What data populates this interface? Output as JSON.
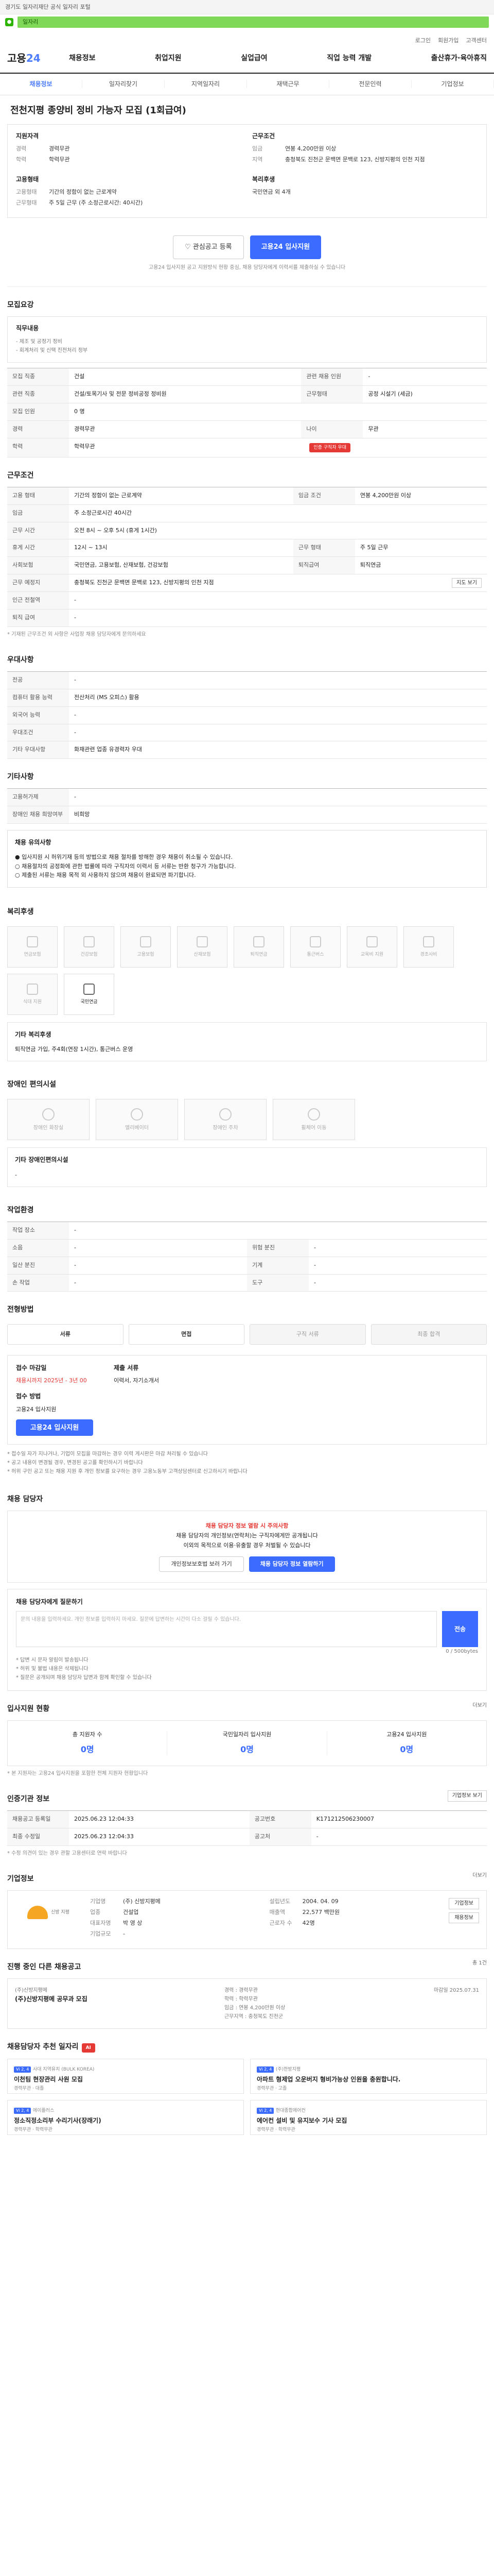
{
  "banner": {
    "top": "경기도 일자리재단 공식 일자리 포털",
    "url": "일자리"
  },
  "util": [
    "로그인",
    "회원가입",
    "고객센터"
  ],
  "gnb": {
    "logo_a": "고용",
    "logo_b": "24",
    "items": [
      "채용정보",
      "취업지원",
      "실업급여",
      "직업 능력 개발",
      "출산휴가·육아휴직"
    ]
  },
  "subnav": [
    "채용정보",
    "일자리찾기",
    "지역일자리",
    "재택근무",
    "전문인력",
    "기업정보"
  ],
  "job": {
    "title": "전천지평 종양비 정비 가능자 모집 (1회급여)"
  },
  "summary": {
    "left_h": "지원자격",
    "left": [
      {
        "k": "경력",
        "v": "경력무관"
      },
      {
        "k": "학력",
        "v": "학력무관"
      }
    ],
    "cond_h": "고용형태",
    "cond": [
      {
        "k": "고용형태",
        "v": "기간의 정함이 없는 근로계약"
      },
      {
        "k": "근무형태",
        "v": "주 5일 근무 (주 소정근로시간: 40시간)"
      }
    ],
    "right_h": "근무조건",
    "right": [
      {
        "k": "임금",
        "v": "연봉 4,200만원 이상"
      },
      {
        "k": "지역",
        "v": "충청북도 진천군 문백면 문백로 123, 신방지평의 인천 지점"
      }
    ],
    "right2_h": "복리후생",
    "right2": [
      {
        "k": "",
        "v": "국민연금 외 4개"
      }
    ],
    "btn_scrap": "관심공고 등록",
    "btn_apply": "고용24 입사지원",
    "note": "고용24 입사지원 공고 지원방식 현황 중심, 채용 담당자에게 이력서를 제출하실 수 있습니다"
  },
  "sec1": {
    "h": "모집요강",
    "h2": "직무내용",
    "bullets": [
      "- 제조 및 공정기 정비",
      "- 회계처리 및 신택 진전처리 정부"
    ],
    "rows": [
      {
        "k": "모집 직종",
        "v": "건설"
      },
      {
        "k": "관련 직종",
        "v": "건설/토목기사 및 전문 정비공정 정비원"
      },
      {
        "k": "모집 인원",
        "v": "0 명"
      },
      {
        "k": "경력",
        "v": "경력무관"
      },
      {
        "k": "학력",
        "v": "학력무관"
      }
    ],
    "rows_r": [
      {
        "k": "관련 채용 인원",
        "v": "-"
      },
      {
        "k": "근무형태",
        "v": "공정 시설기 (세금)"
      },
      {
        "k": "",
        "v": "-"
      },
      {
        "k": "나이",
        "v": "무관"
      }
    ],
    "badge": "인증 구직자 우대"
  },
  "sec2": {
    "h": "근무조건",
    "rows": [
      {
        "k": "고용 형태",
        "v": "기간의 정함이 없는 근로계약"
      },
      {
        "k": "임금",
        "v": "주 소정근로시간 40시간"
      },
      {
        "k": "근무 시간",
        "v": "오전 8시 ~ 오후 5시 (휴게 1시간)"
      },
      {
        "k": "휴게 시간",
        "v": "12시 ~ 13시"
      },
      {
        "k": "사회보험",
        "v": "국민연금, 고용보험, 산재보험, 건강보험"
      },
      {
        "k": "근무 예정지",
        "v": "충청북도 진천군 문백면 문백로 123, 신방지평의 인천 지점"
      },
      {
        "k": "인근 전철역",
        "v": "-"
      },
      {
        "k": "퇴직 급여",
        "v": "-"
      }
    ],
    "rows_r": [
      {
        "k": "임금 조건",
        "v": "연봉 4,200만원 이상"
      },
      {
        "k": "근무 형태",
        "v": "주 5일 근무"
      },
      {
        "k": "퇴직급여",
        "v": "퇴직연금"
      }
    ],
    "map": "지도 보기",
    "foot": "* 기재된 근무조건 외 사항은 사업장 채용 담당자에게 문의하세요"
  },
  "sec3": {
    "h": "우대사항",
    "rows": [
      {
        "k": "전공",
        "v": "-"
      },
      {
        "k": "컴퓨터 활용 능력",
        "v": "전산처리 (MS 오피스) 활용"
      },
      {
        "k": "외국어 능력",
        "v": "-"
      },
      {
        "k": "우대조건",
        "v": "-"
      },
      {
        "k": "기타 우대사항",
        "v": "화재관련 업종 유경력자 우대"
      }
    ]
  },
  "sec4": {
    "h": "기타사항",
    "rows": [
      {
        "k": "고용허가제",
        "v": "-"
      },
      {
        "k": "장애인 채용 희망여부",
        "v": "비희망"
      }
    ],
    "notice_h": "채용 유의사항",
    "notice": [
      "● 입사지원 시 허위기재 등의 방법으로 채용 절차를 방해한 경우 채용이 취소될 수 있습니다.",
      "○ 채용절차의 공정화에 관한 법률에 따라 구직자의 이력서 등 서류는 반환 청구가 가능합니다.",
      "○ 제출된 서류는 채용 목적 외 사용하지 않으며 채용이 완료되면 파기합니다."
    ]
  },
  "sec5": {
    "h": "복리후생",
    "tiles": [
      "연금보험",
      "건강보험",
      "고용보험",
      "산재보험",
      "퇴직연금",
      "통근버스",
      "교육비 지원",
      "경조사비",
      "식대 지원",
      "국민연금"
    ],
    "info_h": "기타 복리후생",
    "info": "퇴직연금 가입, 주4회(연장 1시간), 통근버스 운영"
  },
  "sec6": {
    "h": "장애인 편의시설",
    "tiles": [
      "장애인 화장실",
      "엘리베이터",
      "장애인 주차",
      "휠체어 이동"
    ],
    "info_h": "기타 장애인편의시설",
    "info": "-"
  },
  "sec7": {
    "h": "작업환경",
    "rows": [
      {
        "k": "작업 장소",
        "v": "-"
      },
      {
        "k": "소음",
        "v": "-"
      },
      {
        "k": "일산 분진",
        "v": "-"
      },
      {
        "k": "손 작업",
        "v": "-"
      }
    ],
    "rows_r": [
      {
        "k": "위험 분진",
        "v": "-"
      },
      {
        "k": "기계",
        "v": "-"
      },
      {
        "k": "도구",
        "v": "-"
      }
    ]
  },
  "sec8": {
    "h": "전형방법",
    "steps": [
      "서류",
      "면접",
      "구직 서류",
      "최종 합격"
    ],
    "apply_h": "접수 마감일",
    "apply_v": "채용시까지 2025년 - 3년 00",
    "method_h": "접수 방법",
    "method": "고용24 입사지원",
    "doc_h": "제출 서류",
    "doc": "이력서, 자기소개서",
    "btn": "고용24 입사지원",
    "notes": [
      "* 접수일 자가 지나거나, 기업이 모집을 마감하는 경우 이력 게시판은 마감 처리될 수 있습니다",
      "* 공고 내용이 변경될 경우, 변경된 공고를 확인하시기 바랍니다",
      "* 허위 구인 공고 또는 채용 지원 후 개인 정보를 요구하는 경우 고용노동부 고객상담센터로 신고하시기 바랍니다"
    ]
  },
  "sec9": {
    "h": "채용 담당자",
    "alert": "채용 담당자 정보 열람 시 주의사항",
    "lines": [
      "채용 담당자의 개인정보(연락처)는 구직자에게만 공개됩니다",
      "이외의 목적으로 이용·유출할 경우 처벌될 수 있습니다"
    ],
    "btn1": "개인정보보호법 보러 가기",
    "btn2": "채용 담당자 정보 열람하기",
    "qa_h": "채용 담당자에게 질문하기",
    "qa_ph": "문의 내용을 입력하세요. 개인 정보를 입력하지 마세요. 질문에 답변하는 시간이 다소 걸릴 수 있습니다.",
    "qa_btn": "전송",
    "qa_count": "0 / 500bytes",
    "qa_notes": [
      "* 답변 시 문자 알림이 발송됩니다",
      "* 허위 및 불법 내용은 삭제됩니다",
      "* 질문은 공개되며 채용 담당자 답변과 함께 확인할 수 있습니다"
    ],
    "qa_link": "질문하기"
  },
  "sec10": {
    "h": "입사지원 현황",
    "more": "더보기",
    "stats": [
      {
        "k": "총 지원자 수",
        "v": "0명"
      },
      {
        "k": "국민일자리 입사지원",
        "v": "0명"
      },
      {
        "k": "고용24 입사지원",
        "v": "0명"
      }
    ],
    "note": "* 본 지원자는 고용24 입사지원을 포함한 전체 지원자 현황입니다"
  },
  "sec11": {
    "h": "인증기관 정보",
    "btn": "기업정보 보기",
    "rows": [
      {
        "k": "채용공고 등록일",
        "v": "2025.06.23 12:04:33"
      },
      {
        "k": "최종 수정일",
        "v": "2025.06.23 12:04:33"
      }
    ],
    "rows_r": [
      {
        "k": "공고번호",
        "v": "K171212506230007"
      },
      {
        "k": "공고처",
        "v": "-"
      }
    ],
    "note": "* 수정 의견이 있는 경우 관할 고용센터로 연락 바랍니다"
  },
  "sec12": {
    "h": "기업정보",
    "more": "더보기",
    "logo_txt": "신방 지평",
    "rows": [
      {
        "k": "기업명",
        "v": "(주) 신방지평메"
      },
      {
        "k": "업종",
        "v": "건설업"
      },
      {
        "k": "대표자명",
        "v": "박 영 상"
      },
      {
        "k": "기업규모",
        "v": "-"
      }
    ],
    "rows_r": [
      {
        "k": "설립년도",
        "v": "2004. 04. 09"
      },
      {
        "k": "매출액",
        "v": "22,577 백만원"
      },
      {
        "k": "근로자 수",
        "v": "42명"
      }
    ],
    "btn1": "기업정보",
    "btn2": "채용정보"
  },
  "sec13": {
    "h": "진행 중인 다른 채용공고",
    "total": "총 1건",
    "company": "(주)신방지평메",
    "job": "(주)신방지평메 공무과 모집",
    "detail": [
      "경력 : 경력무관",
      "학력 : 학력무관",
      "임금 : 연봉 4,200만원 이상",
      "근무지역 : 충청북도 진천군"
    ],
    "deadline": "마감일 2025.07.31"
  },
  "sec14": {
    "h": "채용담당자 추천 일자리",
    "ribbon": "AI",
    "cards": [
      {
        "tag": "Vi 2, 4",
        "co": "사대 지역유치 (BULK KOREA)",
        "title": "이천팀 현장관리 사원 모집",
        "meta": "경력무관 · 대졸"
      },
      {
        "tag": "Vi 2, 4",
        "co": "(주)한방지평",
        "title": "아파트 형제업 오운버지 형비가능상 인원을 충원합니다.",
        "meta": "경력무관 · 고졸"
      },
      {
        "tag": "Vi 2, 4",
        "co": "에이플러스",
        "title": "정소직정소리부 수리기사(장래기)",
        "meta": "경력무관 · 학력무관"
      },
      {
        "tag": "Vi 2, 4",
        "co": "현대종합에어컨",
        "title": "에어컨 설비 및 유지보수 기사 모집",
        "meta": "경력무관 · 학력무관"
      }
    ]
  }
}
